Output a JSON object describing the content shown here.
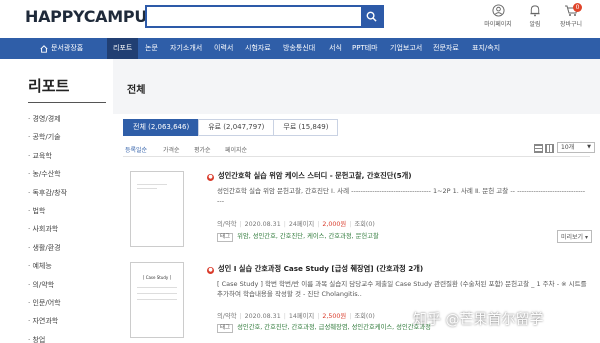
{
  "header": {
    "logo_text": "HAPPYCAMPUS",
    "logo_mark": "!",
    "search_placeholder": "",
    "icons": [
      {
        "name": "mypage",
        "label": "마이페이지"
      },
      {
        "name": "alarm",
        "label": "알림"
      },
      {
        "name": "cart",
        "label": "장바구니",
        "badge": "0"
      }
    ]
  },
  "nav": {
    "home_label": "문서광장홈",
    "items": [
      "리포트",
      "논문",
      "자기소개서",
      "이력서",
      "시험자료",
      "방송통신대",
      "서식",
      "PPT테마",
      "기업보고서",
      "전문자료",
      "표지/속지"
    ],
    "active_index": 0
  },
  "sidebar": {
    "title": "리포트",
    "items": [
      "경영/경제",
      "공학/기술",
      "교육학",
      "농/수산학",
      "독후감/창작",
      "법학",
      "사회과학",
      "생활/환경",
      "예체능",
      "의/약학",
      "인문/어학",
      "자연과학",
      "창업"
    ]
  },
  "content": {
    "title": "전체",
    "tabs": [
      "전체 (2,063,646)",
      "유료 (2,047,797)",
      "무료 (15,849)"
    ],
    "sort": [
      "등록일순",
      "가격순",
      "평가순",
      "페이지순"
    ],
    "page_size": "10개",
    "items": [
      {
        "title": "성인간호학 실습 위암 케이스 스터디 - 문헌고찰, 간호진단(5개)",
        "desc": "성인간호학 실습 위암 문헌고찰, 간호진단 Ⅰ. 사례 ---------------------------------- 1~2P 1. 사례 Ⅱ. 문헌 고찰 -- --------------------------------",
        "author": "의/약학",
        "date": "2020.08.31",
        "pages": "24페이지",
        "price": "2,000원",
        "views": "조회(0)",
        "tag_label": "태그",
        "tags": "위암, 성인간호, 간호진단, 케이스, 간호과정, 문헌고찰",
        "preview": "미리보기",
        "thumb_title": ""
      },
      {
        "title": "성인 I 실습 간호과정 Case Study [급성 췌장염] (간호과정 2개)",
        "desc": "[ Case Study ] 학번 학번/반 이름 과목 실습지 담당교수 제출일 Case Study 관련질환 (수술처된 포함) 문헌고찰 _ 1 주차 - ※ 시트를 추가하여 학습내용을 작성할 것 - 진단 Cholangitis..",
        "author": "의/약학",
        "date": "2020.08.31",
        "pages": "14페이지",
        "price": "2,500원",
        "views": "조회(0)",
        "tag_label": "태그",
        "tags": "성인간호, 간호진단, 간호과정, 급성췌장염, 성인간호케이스, 성인간호과정",
        "preview": "미리보기",
        "thumb_title": "[ Case Study ]"
      }
    ]
  },
  "watermark": "知乎 @芒果首尔留学",
  "colors": {
    "brand_blue": "#2f5ea8",
    "nav_active": "#213f73",
    "price_red": "#d93a2a",
    "tag_green": "#2f7a3a"
  }
}
